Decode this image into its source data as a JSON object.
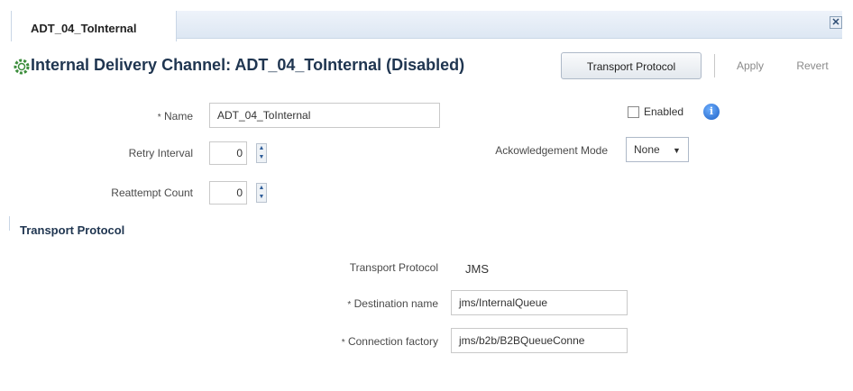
{
  "tab": {
    "label": "ADT_04_ToInternal"
  },
  "header": {
    "title": "Internal Delivery Channel: ADT_04_ToInternal (Disabled)",
    "buttons": {
      "transport": "Transport Protocol",
      "apply": "Apply",
      "revert": "Revert"
    }
  },
  "form": {
    "name": {
      "label": "Name",
      "value": "ADT_04_ToInternal",
      "required": "*"
    },
    "retry_interval": {
      "label": "Retry Interval",
      "value": "0"
    },
    "reattempt_count": {
      "label": "Reattempt Count",
      "value": "0"
    },
    "enabled": {
      "label": "Enabled",
      "checked": false
    },
    "ack_mode": {
      "label": "Ackowledgement Mode",
      "value": "None"
    }
  },
  "transport": {
    "section_title": "Transport Protocol",
    "protocol": {
      "label": "Transport Protocol",
      "value": "JMS"
    },
    "destination": {
      "label": "Destination name",
      "value": "jms/InternalQueue",
      "required": "*"
    },
    "connection_factory": {
      "label": "Connection factory",
      "value": "jms/b2b/B2BQueueConne",
      "required": "*"
    }
  }
}
